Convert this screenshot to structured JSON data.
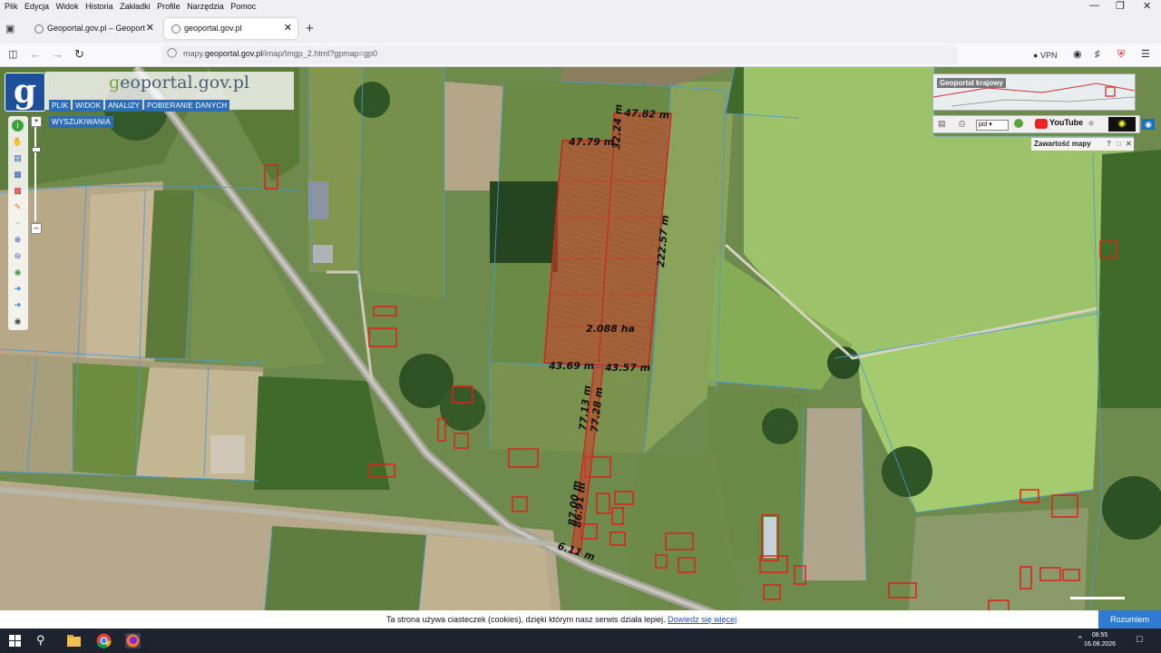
{
  "browser": {
    "menu": [
      "Plik",
      "Edycja",
      "Widok",
      "Historia",
      "Zakładki",
      "Profile",
      "Narzędzia",
      "Pomoc"
    ],
    "tabs": [
      {
        "title": "Geoportal.gov.pl – Geoportal Ir",
        "active": false
      },
      {
        "title": "geoportal.gov.pl",
        "active": true
      }
    ],
    "new_tab": "+",
    "url_prefix": "mapy.",
    "url_domain": "geoportal.gov.pl",
    "url_suffix": "/imap/Imgp_2.html?gpmap=gp0",
    "vpn_label": "VPN"
  },
  "geoportal": {
    "logo_letter": "g",
    "brand_g": "g",
    "brand_rest": "eoportal.gov.pl",
    "menu": [
      "PLIK",
      "WIDOK",
      "ANALIZY",
      "POBIERANIE DANYCH",
      "WYSZUKIWANIA"
    ],
    "overview_title": "Geoportal krajowy",
    "language": "pol",
    "youtube_label": "YouTube",
    "content_panel_title": "Zawartość mapy"
  },
  "map": {
    "parcel_area": "2.088 ha",
    "measurements": [
      "47.82 m",
      "47.79 m",
      "32.24 m",
      "222.57 m",
      "43.69 m",
      "43.57 m",
      "77.13 m",
      "77.28 m",
      "87.00 m",
      "86.91 m",
      "6.11 m"
    ],
    "scale_text": "1:5000"
  },
  "cookie": {
    "text": "Ta strona używa ciasteczek (cookies), dzięki którym nasz serwis działa lepiej.",
    "link": "Dowiedz się więcej",
    "button": "Rozumiem"
  },
  "taskbar": {
    "time": "08:55",
    "date": "16.08.2026"
  },
  "colors": {
    "accent": "#2f6db3",
    "parcel": "#d0201a"
  }
}
